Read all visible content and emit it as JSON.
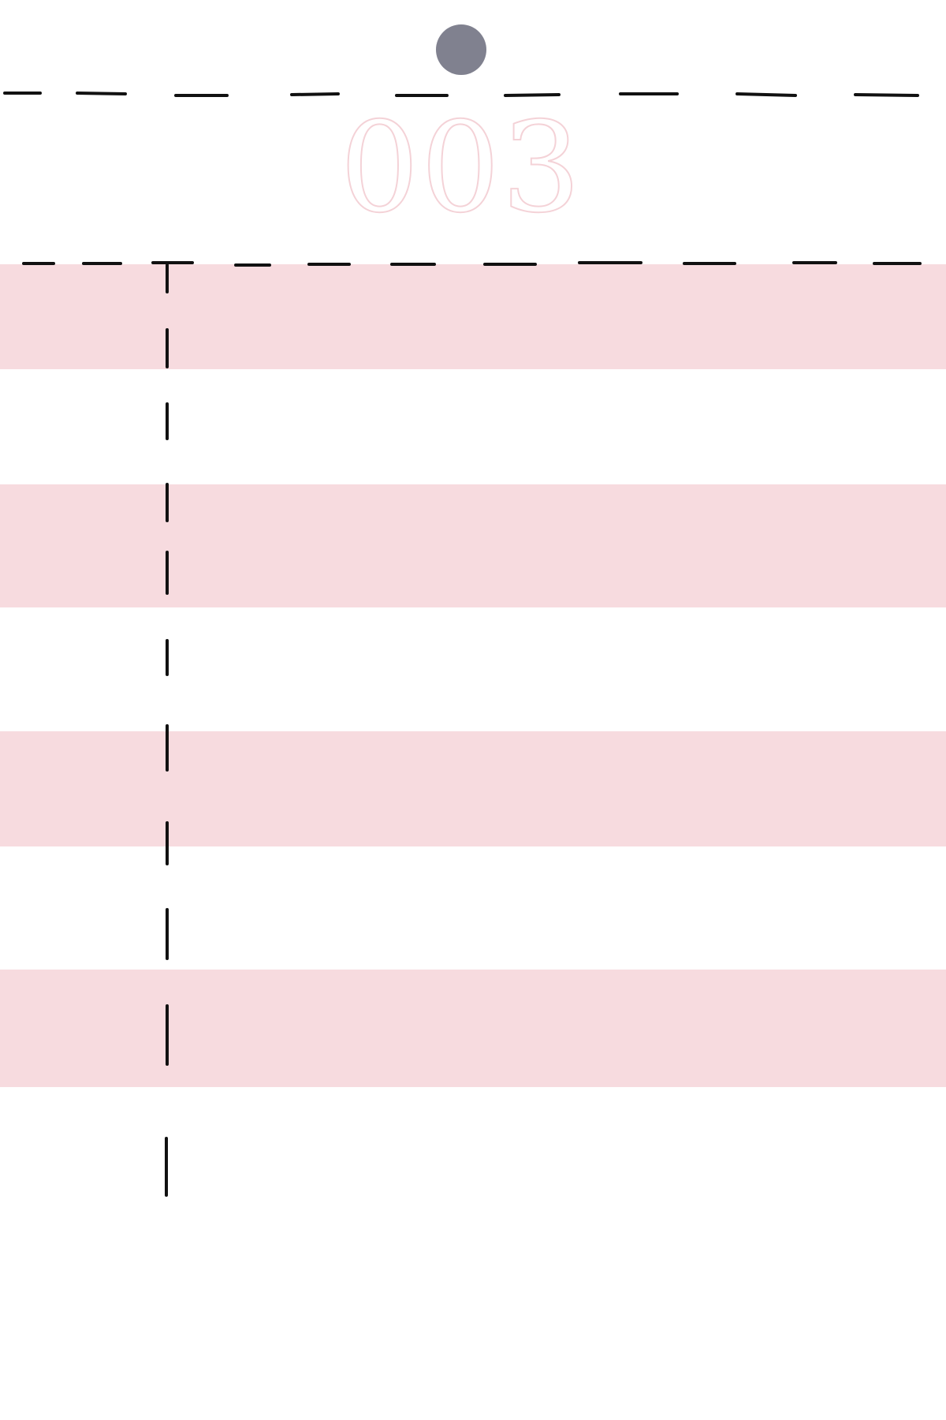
{
  "page": {
    "number": "003"
  },
  "colors": {
    "hole": "#80818f",
    "stripe": "#f7dbdf",
    "number_outline": "#f4d2d7",
    "dash": "#111111"
  }
}
